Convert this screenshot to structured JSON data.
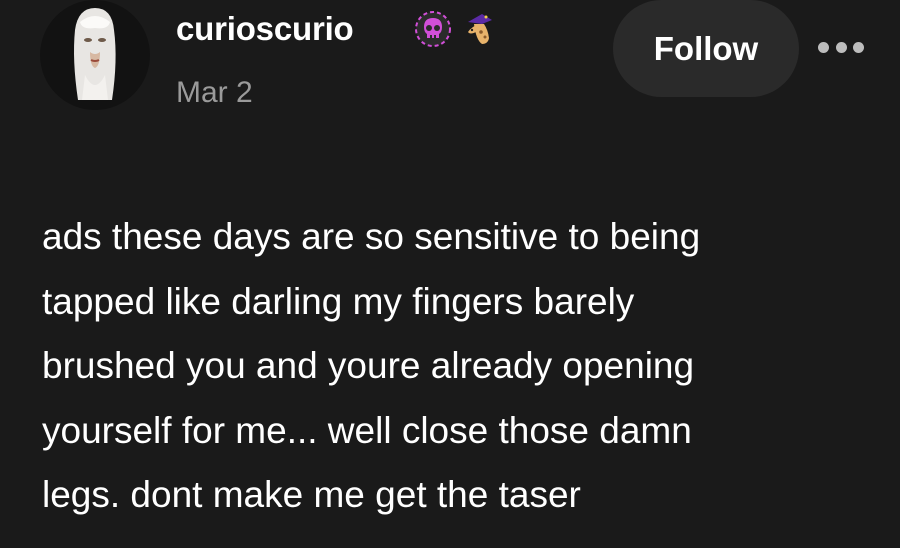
{
  "post": {
    "username": "curioscurio",
    "date": "Mar 2",
    "follow_label": "Follow",
    "more_icon": "more-horizontal-icon",
    "badges": [
      "skull-badge-icon",
      "giraffe-wizard-badge-icon"
    ],
    "body_lines": [
      "ads these days are so sensitive to being",
      "tapped like darling my fingers barely",
      "brushed you and youre already opening",
      "yourself for me... well close those damn",
      "legs. dont make me get the taser"
    ]
  },
  "colors": {
    "background": "#1a1a1a",
    "text": "#ffffff",
    "muted": "#9a9a9a",
    "button_bg": "#2a2a2a",
    "skull_badge": "#d14fd8"
  }
}
